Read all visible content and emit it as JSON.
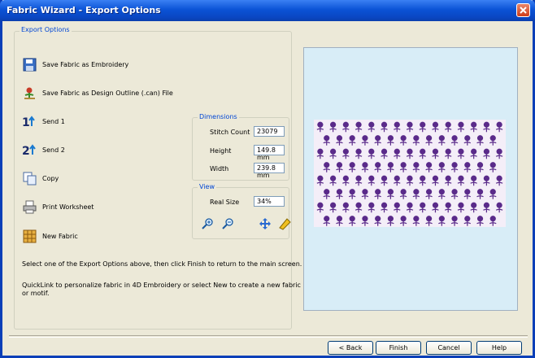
{
  "window": {
    "title": "Fabric Wizard - Export Options"
  },
  "export_options": {
    "legend": "Export Options",
    "items": [
      {
        "label": "Save Fabric as Embroidery",
        "icon": "floppy-disk-icon"
      },
      {
        "label": "Save Fabric as Design Outline (.can) File",
        "icon": "design-outline-icon"
      },
      {
        "label": "Send 1",
        "icon": "send-1-icon"
      },
      {
        "label": "Send 2",
        "icon": "send-2-icon"
      },
      {
        "label": "Copy",
        "icon": "copy-icon"
      },
      {
        "label": "Print Worksheet",
        "icon": "printer-icon"
      },
      {
        "label": "New Fabric",
        "icon": "new-fabric-icon"
      }
    ]
  },
  "dimensions": {
    "legend": "Dimensions",
    "stitch_count_label": "Stitch Count",
    "stitch_count": "23079",
    "height_label": "Height",
    "height": "149.8 mm",
    "width_label": "Width",
    "width": "239.8 mm"
  },
  "view": {
    "legend": "View",
    "real_size_label": "Real Size",
    "real_size": "34%",
    "tools": [
      "zoom-in-icon",
      "zoom-out-icon",
      "pan-icon",
      "measure-icon"
    ]
  },
  "messages": {
    "instruction": "Select one of the Export Options above, then click Finish to return to the main screen.",
    "quicklink_1": "QuickLink to personalize fabric in 4D Embroidery or select New to create a new fabric",
    "quicklink_2": "or motif."
  },
  "buttons": {
    "back": "< Back",
    "finish": "Finish",
    "cancel": "Cancel",
    "help": "Help"
  },
  "colors": {
    "title_bar": "#0b53d6",
    "legend_text": "#0046d5",
    "preview_bg": "#d8edf7",
    "embroidery": "#5a2a8a"
  }
}
